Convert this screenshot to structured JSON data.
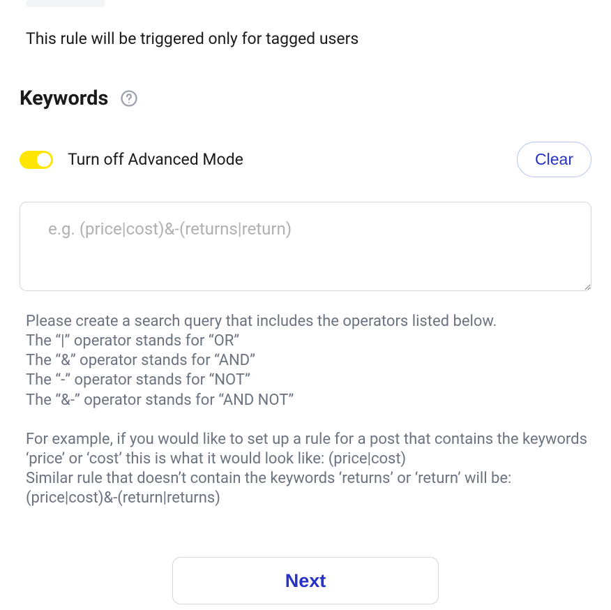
{
  "rule_description": "This rule will be triggered only for tagged users",
  "keywords": {
    "title": "Keywords",
    "toggle_label": "Turn off Advanced Mode",
    "clear_label": "Clear",
    "placeholder": "e.g. (price|cost)&-(returns|return)",
    "help": {
      "intro": "Please create a search query that includes the operators listed below.",
      "line1": "The “|” operator stands for “OR”",
      "line2": "The “&” operator stands for “AND”",
      "line3": "The “-” operator stands for “NOT”",
      "line4": "The “&-” operator stands for “AND NOT”",
      "example1": "For example, if you would like to set up a rule for a post that contains the keywords ‘price’ or ‘cost’ this is what it would look like: (price|cost)",
      "example2": "Similar rule that doesn’t contain the keywords ‘returns’ or ‘return’ will be: (price|cost)&-(return|returns)"
    }
  },
  "next_label": "Next"
}
